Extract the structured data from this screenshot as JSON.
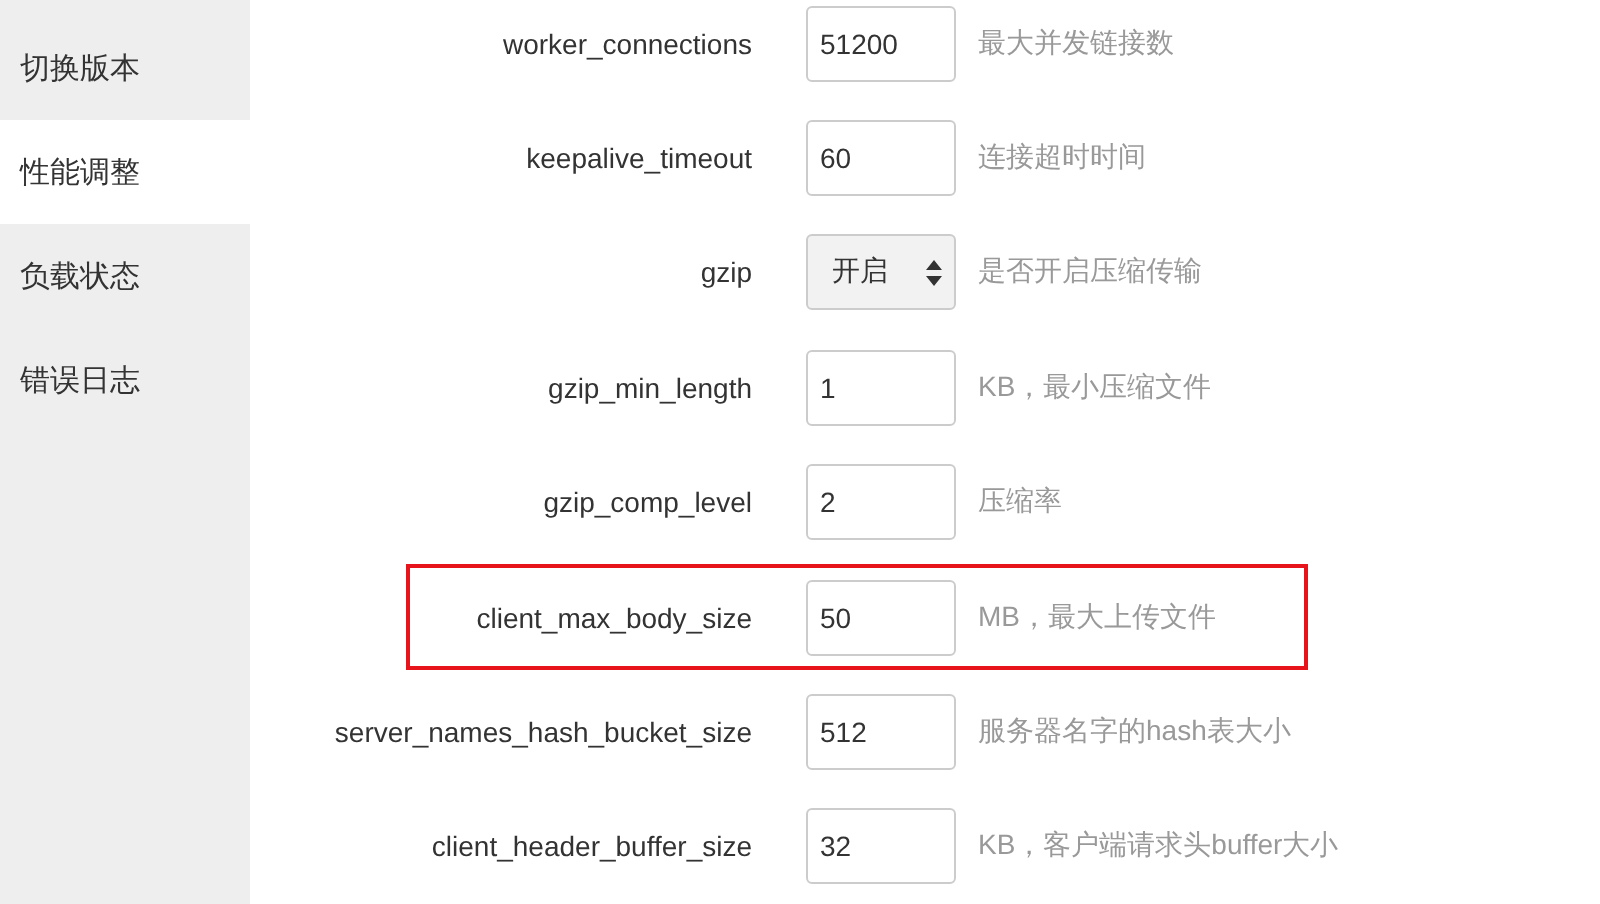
{
  "sidebar": {
    "items": [
      {
        "label": "切换版本",
        "selected": false
      },
      {
        "label": "性能调整",
        "selected": true
      },
      {
        "label": "负载状态",
        "selected": false
      },
      {
        "label": "错误日志",
        "selected": false
      }
    ]
  },
  "settings": [
    {
      "name": "worker_connections",
      "kind": "input",
      "value": "51200",
      "hint": "最大并发链接数",
      "highlighted": false
    },
    {
      "name": "keepalive_timeout",
      "kind": "input",
      "value": "60",
      "hint": "连接超时时间",
      "highlighted": false
    },
    {
      "name": "gzip",
      "kind": "select",
      "value": "开启",
      "hint": "是否开启压缩传输",
      "highlighted": false
    },
    {
      "name": "gzip_min_length",
      "kind": "input",
      "value": "1",
      "hint": "KB，最小压缩文件",
      "highlighted": false
    },
    {
      "name": "gzip_comp_level",
      "kind": "input",
      "value": "2",
      "hint": "压缩率",
      "highlighted": false
    },
    {
      "name": "client_max_body_size",
      "kind": "input",
      "value": "50",
      "hint": "MB，最大上传文件",
      "highlighted": true
    },
    {
      "name": "server_names_hash_bucket_size",
      "kind": "input",
      "value": "512",
      "hint": "服务器名字的hash表大小",
      "highlighted": false
    },
    {
      "name": "client_header_buffer_size",
      "kind": "input",
      "value": "32",
      "hint": "KB，客户端请求头buffer大小",
      "highlighted": false
    }
  ]
}
